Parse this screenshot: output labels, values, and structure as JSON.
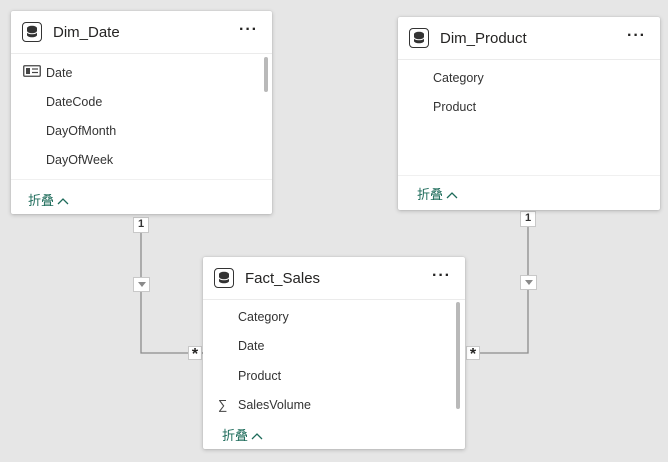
{
  "colors": {
    "canvas": "#e6e6e6",
    "card": "#ffffff",
    "connector": "#8c8c8c",
    "collapse_text": "#1d6b5a"
  },
  "tables": {
    "dim_date": {
      "title": "Dim_Date",
      "more": "···",
      "fields": [
        "Date",
        "DateCode",
        "DayOfMonth",
        "DayOfWeek"
      ],
      "field_icons": [
        "calendar-key-icon",
        "",
        "",
        ""
      ],
      "collapse_label": "折叠"
    },
    "dim_product": {
      "title": "Dim_Product",
      "more": "···",
      "fields": [
        "Category",
        "Product"
      ],
      "collapse_label": "折叠"
    },
    "fact_sales": {
      "title": "Fact_Sales",
      "more": "···",
      "fields": [
        "Category",
        "Date",
        "Product",
        "SalesVolume"
      ],
      "field_icons": [
        "",
        "",
        "",
        "sum-icon"
      ],
      "sum_symbol": "∑",
      "collapse_label": "折叠"
    }
  },
  "relationships": [
    {
      "from": "Dim_Date",
      "to": "Fact_Sales",
      "from_cardinality": "1",
      "to_cardinality": "*"
    },
    {
      "from": "Dim_Product",
      "to": "Fact_Sales",
      "from_cardinality": "1",
      "to_cardinality": "*"
    }
  ]
}
